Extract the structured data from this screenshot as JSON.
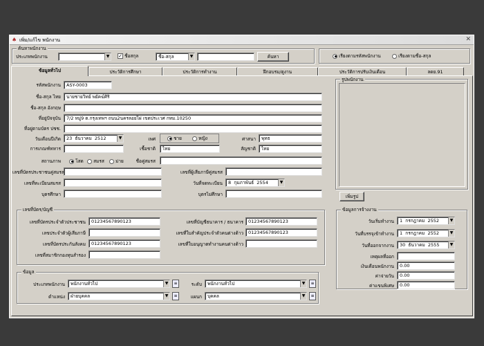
{
  "window": {
    "title": "เพิ่ม/แก้ไข พนักงาน"
  },
  "search": {
    "group_title": "ค้นหาพนักงาน",
    "type_label": "ประเภทพนักงาน",
    "type_value": "",
    "name_check_label": "ชื่อสกุล",
    "name_field_value": "ชื่อ-สกุล",
    "name_text_value": "",
    "search_button": "ค้นหา",
    "radio_by_code": "เรียงตามรหัสพนักงาน",
    "radio_by_name": "เรียงตามชื่อ-สกุล"
  },
  "tabs": [
    "ข้อมูลทั่วไป",
    "ประวัติการศึกษา",
    "ประวัติการทำงาน",
    "ฝึกอบรม/ดูงาน",
    "ประวัติการปรับเงินเดือน",
    "ลดย.91"
  ],
  "general": {
    "code_label": "รหัสพนักงาน",
    "code_value": "ASY-0003",
    "name_th_label": "ชื่อ-สกุล ไทย",
    "name_th_value": "นายชายวิทย์ พยัคฆ์ศิริ",
    "name_en_label": "ชื่อ-สกุล อังกฤษ",
    "name_en_value": "",
    "address_label": "ที่อยู่ปัจจุบัน",
    "address_value": "7/2 หมู่9 ต.กรุงเทพฯ ถนน2นครลอยไผ่ เขตประเวศ กทม.10250",
    "address_reg_label": "ที่อยู่ตามบัตร ปชช.",
    "address_reg_value": "",
    "dob_label": "วันเดือนปีเกิด",
    "dob_day": "23",
    "dob_month": "ธันวาคม",
    "dob_year": "2512",
    "military_label": "การเกณฑ์ทหาร",
    "military_value": "",
    "gender_label": "เพศ",
    "gender_male": "ชาย",
    "gender_female": "หญิง",
    "origin_label": "เชื้อชาติ",
    "origin_value": "ไทย",
    "religion_label": "ศาสนา",
    "religion_value": "พุทธ",
    "nationality_label": "สัญชาติ",
    "nationality_value": "ไทย",
    "marital_label": "สถานภาพ",
    "marital_single": "โสด",
    "marital_married": "สมรส",
    "marital_widow": "ม่าย",
    "spouse_label": "ชื่อคู่สมรส",
    "spouse_value": "",
    "spouse_id_label": "เลขที่บัตรประชาชนคู่สมรส",
    "spouse_id_value": "",
    "spouse_tax_label": "เลขที่ผู้เสียภาษีคู่สมรส",
    "spouse_tax_value": "",
    "reg_no_label": "เลขที่ทะเบียนสมรส",
    "reg_no_value": "",
    "reg_date_label": "วันที่จดทะเบียน",
    "reg_day": "8",
    "reg_month": "กุมภาพันธ์",
    "reg_year": "2554",
    "children_study_label": "บุตรศึกษา",
    "children_study_value": "",
    "children_nostudy_label": "บุตรไม่ศึกษา",
    "children_nostudy_value": ""
  },
  "photo": {
    "group_title": "รูปพนักงาน",
    "add_button": "เพิ่มรูป"
  },
  "cards": {
    "group_title": "เลขที่บัตร/บัญชี",
    "id_label": "เลขที่บัตรประจำตัวประชาชน",
    "id_value": "01234567890123",
    "tax_label": "เลขประจำตัวผู้เสียภาษี",
    "tax_value": "",
    "sso_label": "เลขที่บัตรประกันสังคม",
    "sso_value": "01234567890123",
    "fund_label": "เลขที่สมาชิกกองทุนสำรอง",
    "fund_value": "",
    "bank_label": "เลขที่บัญชีธนาคาร / ธนาคาร",
    "bank_value": "01234567890123",
    "work_permit_label": "เลขที่ใบสำคัญประจำตัวคนต่างด้าว",
    "work_permit_value": "01234567890123",
    "license_label": "เลขที่ใบอนุญาตทำงานคนต่างด้าว",
    "license_value": ""
  },
  "employment": {
    "group_title": "ข้อมูลการจ้างงาน",
    "start_label": "วันเริ่มทำงาน",
    "start_day": "1",
    "start_month": "กรกฎาคม",
    "start_year": "2552",
    "permanent_label": "วันที่บรรจุเข้าทำงาน",
    "permanent_day": "1",
    "permanent_month": "กรกฎาคม",
    "permanent_year": "2552",
    "leave_label": "วันที่ออกจากงาน",
    "leave_day": "30",
    "leave_month": "ธันวาคม",
    "leave_year": "2555",
    "reason_label": "เหตุผลที่ออก",
    "reason_value": "",
    "salary_label": "เงินเดือนพนักงาน",
    "salary_value": "0.00",
    "daily_label": "ค่าจ่ายวัน",
    "daily_value": "0.00",
    "allowance_label": "ค่าแขนพิเศษ",
    "allowance_value": "0.00"
  },
  "info": {
    "group_title": "ข้อมูล",
    "emp_type_label": "ประเภทพนักงาน",
    "emp_type_value": "พนักงานทั่วไป",
    "level_label": "ระดับ",
    "level_value": "พนักงานทั่วไป",
    "position_label": "ตำแหน่ง",
    "position_value": "ฝ่ายบุคคล",
    "dept_label": "แผนก",
    "dept_value": "บุคคล"
  }
}
